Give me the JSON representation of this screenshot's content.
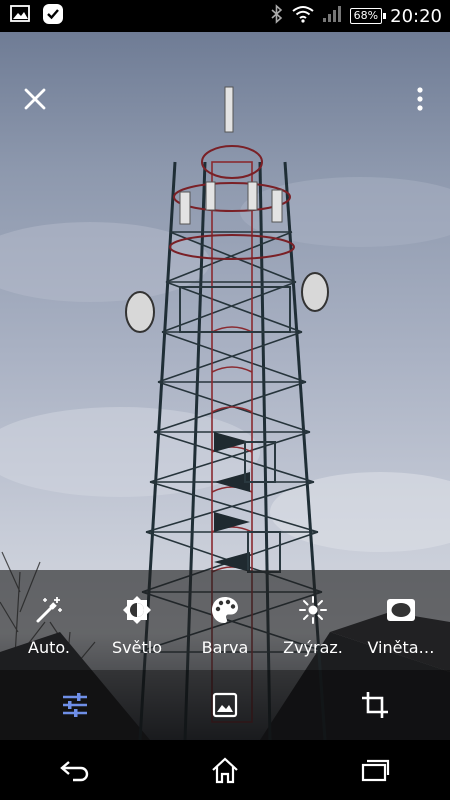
{
  "status_bar": {
    "time": "20:20",
    "battery": "68%",
    "left_icons": [
      "gallery-notification-icon",
      "checkmark-app-icon"
    ],
    "right_icons": [
      "bluetooth-icon",
      "wifi-icon",
      "signal-icon",
      "battery-icon"
    ]
  },
  "top_bar": {
    "close_icon": "close-icon",
    "more_icon": "more-vert-icon"
  },
  "tools": [
    {
      "label": "Auto.",
      "icon": "auto-fix-icon"
    },
    {
      "label": "Světlo",
      "icon": "brightness-icon"
    },
    {
      "label": "Barva",
      "icon": "palette-icon"
    },
    {
      "label": "Zvýraz.",
      "icon": "highlight-icon"
    },
    {
      "label": "Viněta…",
      "icon": "vignette-icon"
    }
  ],
  "edit_tabs": [
    {
      "icon": "adjust-sliders-icon",
      "active": true
    },
    {
      "icon": "filters-image-icon",
      "active": false
    },
    {
      "icon": "crop-icon",
      "active": false
    }
  ],
  "navbar": [
    "back-icon",
    "home-icon",
    "recents-icon"
  ],
  "colors": {
    "accent": "#6f8fe8",
    "tool_bar_bg": "#1e1e1e",
    "status_bg": "#000000"
  }
}
